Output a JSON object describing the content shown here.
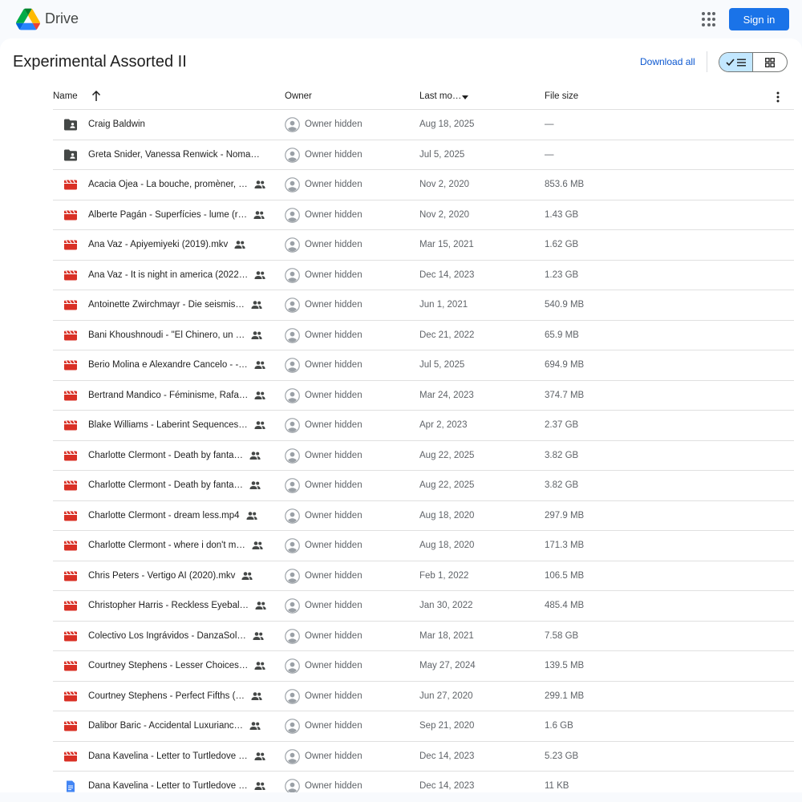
{
  "app": {
    "name": "Drive",
    "signin_label": "Sign in"
  },
  "icons": {
    "logo": "google-drive-logo",
    "apps": "apps-grid-icon"
  },
  "colors": {
    "accent": "#1a73e8",
    "video": "#d93025",
    "doc": "#4285f4",
    "folder": "#444746",
    "toggle_active": "#c2e7ff"
  },
  "page": {
    "title": "Experimental Assorted II",
    "download_all": "Download all",
    "view": "list"
  },
  "columns": {
    "name": "Name",
    "owner": "Owner",
    "modified": "Last mo…",
    "size": "File size",
    "sort": "ascending"
  },
  "rows": [
    {
      "type": "folder",
      "name": "Craig Baldwin",
      "shared": false,
      "owner": "Owner hidden",
      "modified": "Aug 18, 2025",
      "size": "—"
    },
    {
      "type": "folder",
      "name": "Greta Snider, Vanessa Renwick  - Noma…",
      "shared": false,
      "owner": "Owner hidden",
      "modified": "Jul 5, 2025",
      "size": "—"
    },
    {
      "type": "video",
      "name": "Acacia Ojea - La bouche, promèner, …",
      "shared": true,
      "owner": "Owner hidden",
      "modified": "Nov 2, 2020",
      "size": "853.6 MB"
    },
    {
      "type": "video",
      "name": "Alberte Pagán - Superfícies - lume (r…",
      "shared": true,
      "owner": "Owner hidden",
      "modified": "Nov 2, 2020",
      "size": "1.43 GB"
    },
    {
      "type": "video",
      "name": "Ana Vaz - Apiyemiyeki (2019).mkv",
      "shared": true,
      "owner": "Owner hidden",
      "modified": "Mar 15, 2021",
      "size": "1.62 GB"
    },
    {
      "type": "video",
      "name": "Ana Vaz - It is night in america (2022…",
      "shared": true,
      "owner": "Owner hidden",
      "modified": "Dec 14, 2023",
      "size": "1.23 GB"
    },
    {
      "type": "video",
      "name": "Antoinette Zwirchmayr - Die seismis…",
      "shared": true,
      "owner": "Owner hidden",
      "modified": "Jun 1, 2021",
      "size": "540.9 MB"
    },
    {
      "type": "video",
      "name": "Bani Khoushnoudi - \"El Chinero, un …",
      "shared": true,
      "owner": "Owner hidden",
      "modified": "Dec 21, 2022",
      "size": "65.9 MB"
    },
    {
      "type": "video",
      "name": "Berio Molina e Alexandre Cancelo - -…",
      "shared": true,
      "owner": "Owner hidden",
      "modified": "Jul 5, 2025",
      "size": "694.9 MB"
    },
    {
      "type": "video",
      "name": "Bertrand Mandico - Féminisme, Rafa…",
      "shared": true,
      "owner": "Owner hidden",
      "modified": "Mar 24, 2023",
      "size": "374.7 MB"
    },
    {
      "type": "video",
      "name": "Blake Williams - Laberint Sequences…",
      "shared": true,
      "owner": "Owner hidden",
      "modified": "Apr 2, 2023",
      "size": "2.37 GB"
    },
    {
      "type": "video",
      "name": "Charlotte Clermont - Death by fanta…",
      "shared": true,
      "owner": "Owner hidden",
      "modified": "Aug 22, 2025",
      "size": "3.82 GB"
    },
    {
      "type": "video",
      "name": "Charlotte Clermont - Death by fanta…",
      "shared": true,
      "owner": "Owner hidden",
      "modified": "Aug 22, 2025",
      "size": "3.82 GB"
    },
    {
      "type": "video",
      "name": "Charlotte Clermont - dream less.mp4",
      "shared": true,
      "owner": "Owner hidden",
      "modified": "Aug 18, 2020",
      "size": "297.9 MB"
    },
    {
      "type": "video",
      "name": "Charlotte Clermont - where i don't m…",
      "shared": true,
      "owner": "Owner hidden",
      "modified": "Aug 18, 2020",
      "size": "171.3 MB"
    },
    {
      "type": "video",
      "name": "Chris Peters - Vertigo AI (2020).mkv",
      "shared": true,
      "owner": "Owner hidden",
      "modified": "Feb 1, 2022",
      "size": "106.5 MB"
    },
    {
      "type": "video",
      "name": "Christopher Harris - Reckless Eyebal…",
      "shared": true,
      "owner": "Owner hidden",
      "modified": "Jan 30, 2022",
      "size": "485.4 MB"
    },
    {
      "type": "video",
      "name": "Colectivo Los Ingrávidos - DanzaSol…",
      "shared": true,
      "owner": "Owner hidden",
      "modified": "Mar 18, 2021",
      "size": "7.58 GB"
    },
    {
      "type": "video",
      "name": "Courtney Stephens - Lesser Choices…",
      "shared": true,
      "owner": "Owner hidden",
      "modified": "May 27, 2024",
      "size": "139.5 MB"
    },
    {
      "type": "video",
      "name": "Courtney Stephens - Perfect Fifths (…",
      "shared": true,
      "owner": "Owner hidden",
      "modified": "Jun 27, 2020",
      "size": "299.1 MB"
    },
    {
      "type": "video",
      "name": "Dalibor Baric - Accidental Luxurianc…",
      "shared": true,
      "owner": "Owner hidden",
      "modified": "Sep 21, 2020",
      "size": "1.6 GB"
    },
    {
      "type": "video",
      "name": "Dana Kavelina - Letter to Turtledove …",
      "shared": true,
      "owner": "Owner hidden",
      "modified": "Dec 14, 2023",
      "size": "5.23 GB"
    },
    {
      "type": "doc",
      "name": "Dana Kavelina - Letter to Turtledove …",
      "shared": true,
      "owner": "Owner hidden",
      "modified": "Dec 14, 2023",
      "size": "11 KB"
    }
  ]
}
